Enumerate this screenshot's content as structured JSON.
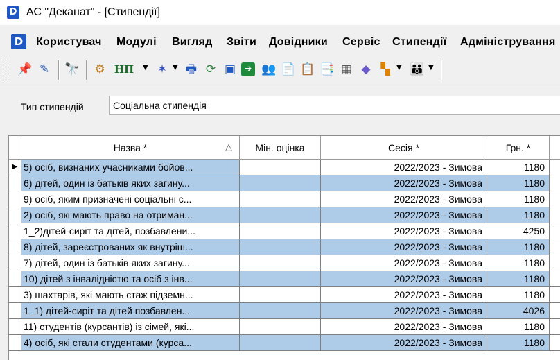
{
  "window": {
    "title": "АС \"Деканат\" - [Стипендії]",
    "app_icon_letter": "D"
  },
  "menu": {
    "icon_letter": "D",
    "items": [
      "Користувач",
      "Модулі",
      "Вигляд",
      "Звіти",
      "Довідники",
      "Сервіс",
      "Стипендії",
      "Адміністрування"
    ]
  },
  "toolbar": {
    "np_label": "НП",
    "buttons": [
      {
        "name": "pin-icon",
        "glyph": "📌"
      },
      {
        "name": "highlight-icon",
        "glyph": "✎"
      },
      {
        "name": "binoculars-icon",
        "glyph": "🔭"
      },
      {
        "name": "gears-icon",
        "glyph": "⚙"
      },
      {
        "name": "star-icon",
        "glyph": "✶"
      },
      {
        "name": "print-icon",
        "glyph": "🖶"
      },
      {
        "name": "refresh-icon",
        "glyph": "⟳"
      },
      {
        "name": "window-icon",
        "glyph": "▣"
      },
      {
        "name": "export-icon",
        "glyph": "➔"
      },
      {
        "name": "people-icon",
        "glyph": "👥"
      },
      {
        "name": "document-icon",
        "glyph": "📄"
      },
      {
        "name": "report-icon",
        "glyph": "📋"
      },
      {
        "name": "report-edit-icon",
        "glyph": "📑"
      },
      {
        "name": "calculator-icon",
        "glyph": "▦"
      },
      {
        "name": "eraser-icon",
        "glyph": "◆"
      },
      {
        "name": "blocks-icon",
        "glyph": "▚"
      },
      {
        "name": "users-icon",
        "glyph": "👪"
      }
    ]
  },
  "filter": {
    "label": "Тип стипендій",
    "value": "Соціальна стипендія"
  },
  "table": {
    "columns": [
      "Назва *",
      "Мін. оцінка",
      "Сесія *",
      "Грн. *"
    ],
    "sort_indicator": "△",
    "current_row_marker": "▶",
    "rows": [
      {
        "name": "5) осіб, визнаних учасниками бойов...",
        "min": "",
        "session": "2022/2023 - Зимова",
        "uah": "1180"
      },
      {
        "name": "6) дітей, один із батьків яких загину...",
        "min": "",
        "session": "2022/2023 - Зимова",
        "uah": "1180"
      },
      {
        "name": "9) осіб, яким призначені соціальні с...",
        "min": "",
        "session": "2022/2023 - Зимова",
        "uah": "1180"
      },
      {
        "name": "2) осіб, які мають право на отриман...",
        "min": "",
        "session": "2022/2023 - Зимова",
        "uah": "1180"
      },
      {
        "name": "1_2)дітей-сиріт та дітей, позбавлени...",
        "min": "",
        "session": "2022/2023 - Зимова",
        "uah": "4250"
      },
      {
        "name": "8) дітей, зареєстрованих як внутріш...",
        "min": "",
        "session": "2022/2023 - Зимова",
        "uah": "1180"
      },
      {
        "name": "7) дітей, один із батьків яких загину...",
        "min": "",
        "session": "2022/2023 - Зимова",
        "uah": "1180"
      },
      {
        "name": "10) дітей з інвалідністю та осіб з інв...",
        "min": "",
        "session": "2022/2023 - Зимова",
        "uah": "1180"
      },
      {
        "name": "3) шахтарів, які мають стаж підземн...",
        "min": "",
        "session": "2022/2023 - Зимова",
        "uah": "1180"
      },
      {
        "name": "1_1) дітей-сиріт та дітей  позбавлен...",
        "min": "",
        "session": "2022/2023 - Зимова",
        "uah": "4026"
      },
      {
        "name": "11) студентів (курсантів) із сімей, які...",
        "min": "",
        "session": "2022/2023 - Зимова",
        "uah": "1180"
      },
      {
        "name": "4) осіб, які стали студентами (курса...",
        "min": "",
        "session": "2022/2023 - Зимова",
        "uah": "1180"
      }
    ]
  },
  "colors": {
    "row_highlight": "#aecbe8",
    "app_icon": "#1f57c3"
  }
}
